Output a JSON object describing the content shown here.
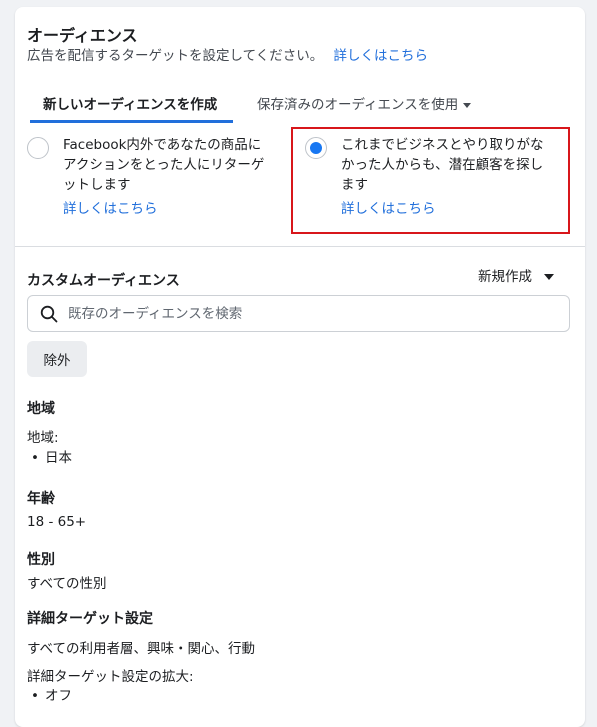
{
  "audience": {
    "title": "オーディエンス",
    "subtitle": "広告を配信するターゲットを設定してください。",
    "learn_more": "詳しくはこちら"
  },
  "tabs": {
    "new_label": "新しいオーディエンスを作成",
    "saved_label": "保存済みのオーディエンスを使用"
  },
  "options": [
    {
      "lines": [
        "Facebook内外であなたの商品に",
        "アクションをとった人にリターゲ",
        "ットします"
      ],
      "link": "詳しくはこちら",
      "selected": false
    },
    {
      "lines": [
        "これまでビジネスとやり取りがな",
        "かった人からも、潜在顧客を探し",
        "ます"
      ],
      "link": "詳しくはこちら",
      "selected": true
    }
  ],
  "custom_audience": {
    "title": "カスタムオーディエンス",
    "new_create": "新規作成",
    "search_placeholder": "既存のオーディエンスを検索",
    "exclude": "除外"
  },
  "location": {
    "title": "地域",
    "label": "地域:",
    "items": [
      "日本"
    ]
  },
  "age": {
    "title": "年齢",
    "value": "18 - 65+"
  },
  "gender": {
    "title": "性別",
    "value": "すべての性別"
  },
  "detailed": {
    "title": "詳細ターゲット設定",
    "value": "すべての利用者層、興味・関心、行動",
    "expansion_label": "詳細ターゲット設定の拡大:",
    "expansion_items": [
      "オフ"
    ]
  },
  "colors": {
    "accent": "#216fdb",
    "radio_selected": "#1877f2",
    "highlight": "#d8161b"
  }
}
